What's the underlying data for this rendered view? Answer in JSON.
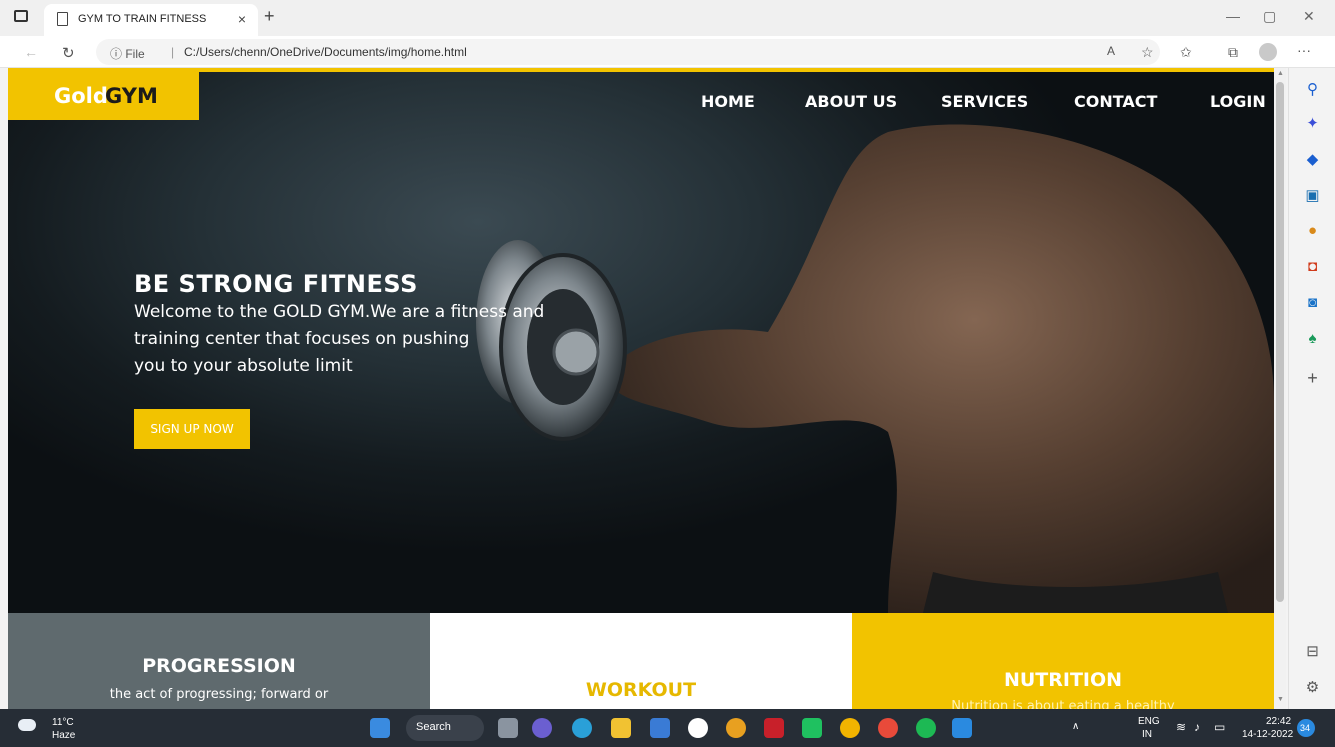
{
  "browser": {
    "tab_title": "GYM TO TRAIN FITNESS",
    "tab_close": "×",
    "new_tab": "+",
    "url_prefix": "ⓘ File",
    "url": "C:/Users/chenn/OneDrive/Documents/img/home.html",
    "read_aloud": "A",
    "more": "···"
  },
  "site": {
    "logo_gold": "Gold",
    "logo_gym": "GYM",
    "nav": {
      "home": "HOME",
      "about": "ABOUT US",
      "services": "SERVICES",
      "contact": "CONTACT",
      "login": "LOGIN"
    },
    "hero": {
      "title": "BE STRONG FITNESS",
      "line1": "Welcome to the GOLD GYM.We are a fitness and",
      "line2": "training center that focuses on pushing",
      "line3": "you to your absolute limit",
      "cta": "SIGN UP NOW"
    },
    "cards": {
      "progression_title": "PROGRESSION",
      "progression_desc": "the act of progressing; forward or",
      "workout_title": "WORKOUT",
      "nutrition_title": "NUTRITION",
      "nutrition_desc": "Nutrition is about eating a healthy"
    }
  },
  "colors": {
    "accent": "#f2c300",
    "card_grey": "#5f6a6e"
  },
  "taskbar": {
    "weather_temp": "11°C",
    "weather_desc": "Haze",
    "search_label": "Search",
    "lang_top": "ENG",
    "lang_bottom": "IN",
    "time": "22:42",
    "date": "14-12-2022",
    "notif_count": "34"
  }
}
